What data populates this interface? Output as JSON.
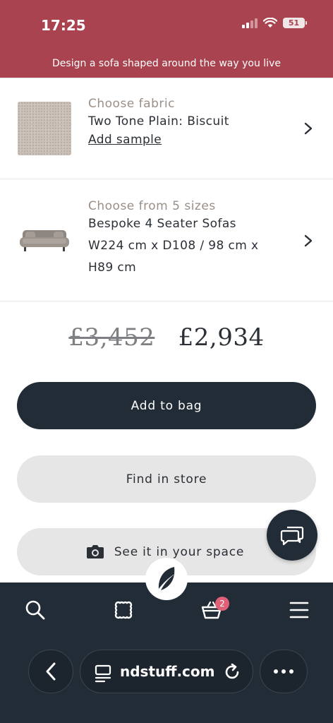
{
  "status_bar": {
    "time": "17:25",
    "battery": "51"
  },
  "promo": {
    "text": "Design a sofa shaped around the way you live"
  },
  "fabric_option": {
    "label": "Choose fabric",
    "value": "Two Tone Plain: Biscuit",
    "link": "Add sample",
    "icon": "fabric-swatch"
  },
  "size_option": {
    "label": "Choose from 5 sizes",
    "value_line1": "Bespoke 4 Seater Sofas",
    "value_line2": "W224 cm x D108 / 98 cm x",
    "value_line3": "H89 cm",
    "icon": "sofa-thumbnail"
  },
  "price": {
    "original": "£3,452",
    "current": "£2,934"
  },
  "buttons": {
    "add_to_bag": "Add to bag",
    "find_in_store": "Find in store",
    "see_in_space": "See it in your space"
  },
  "bottom_nav": {
    "items": [
      "search-icon",
      "fabric-swatch-icon",
      "basket-icon",
      "menu-icon"
    ],
    "basket_count": "2"
  },
  "browser": {
    "url": "ndstuff.com"
  },
  "colors": {
    "brand": "#a9434f",
    "dark": "#222c36",
    "badge": "#e06077"
  }
}
